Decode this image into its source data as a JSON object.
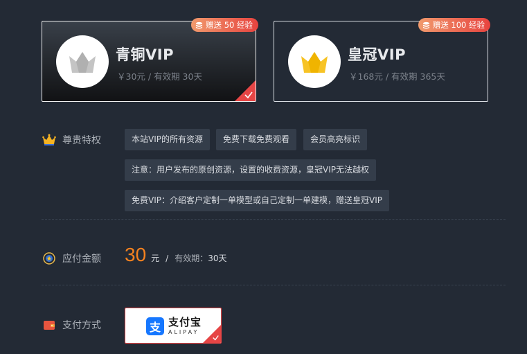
{
  "plans": [
    {
      "name": "青铜VIP",
      "desc": "￥30元 / 有效期 30天",
      "badge": "赠送 50 经验",
      "selected": true,
      "crown_color": "#c4c4c4"
    },
    {
      "name": "皇冠VIP",
      "desc": "￥168元 / 有效期 365天",
      "badge": "赠送 100 经验",
      "selected": false,
      "crown_color": "#f7c325"
    }
  ],
  "privileges": {
    "label": "尊贵特权",
    "icon": "crown-icon",
    "tags": [
      "本站VIP的所有资源",
      "免费下载免费观看",
      "会员高亮标识",
      "注意：用户发布的原创资源，设置的收费资源，皇冠VIP无法越权",
      "免费VIP：介绍客户定制一单模型或自己定制一单建模，赠送皇冠VIP"
    ]
  },
  "payment_amount": {
    "label": "应付金额",
    "icon": "medal-icon",
    "amount": "30",
    "unit": "元",
    "separator": "/",
    "validity_label": "有效期：",
    "validity_value": "30天"
  },
  "payment_method": {
    "label": "支付方式",
    "icon": "wallet-icon",
    "option_name": "支付宝",
    "option_en": "ALIPAY",
    "logo_char": "支"
  },
  "colors": {
    "background": "#232a35",
    "accent_orange": "#f5821f",
    "selected_red": "#e64545",
    "badge_gradient_start": "#f19a6d",
    "badge_gradient_end": "#e7433f",
    "alipay_blue": "#1677ff"
  }
}
